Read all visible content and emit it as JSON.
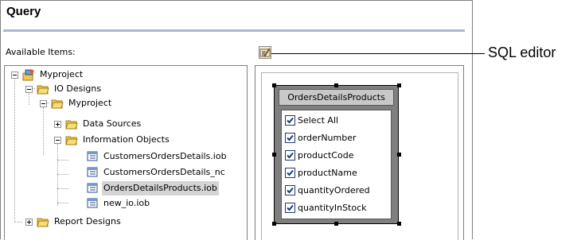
{
  "panel": {
    "title": "Query",
    "available_label": "Available Items:"
  },
  "toolbar": {
    "sql_editor_icon": "sql-editor-icon"
  },
  "callout": {
    "text": "SQL editor"
  },
  "tree": {
    "root": {
      "label": "Myproject",
      "icon": "project-icon"
    },
    "io_designs": {
      "label": "IO Designs",
      "icon": "folder-icon"
    },
    "myproject": {
      "label": "Myproject",
      "icon": "folder-icon"
    },
    "data_sources": {
      "label": "Data Sources",
      "icon": "folder-icon"
    },
    "information_objects": {
      "label": "Information Objects",
      "icon": "folder-icon"
    },
    "items": [
      {
        "label": "CustomersOrdersDetails.iob",
        "icon": "information-object-icon"
      },
      {
        "label": "CustomersOrdersDetails_nc",
        "icon": "information-object-icon"
      },
      {
        "label": "OrdersDetailsProducts.iob",
        "icon": "information-object-icon",
        "selected": true
      },
      {
        "label": "new_io.iob",
        "icon": "information-object-icon"
      }
    ],
    "report_designs": {
      "label": "Report Designs",
      "icon": "folder-icon"
    }
  },
  "table": {
    "title": "OrdersDetailsProducts",
    "fields": [
      {
        "label": "Select All",
        "checked": true
      },
      {
        "label": "orderNumber",
        "checked": true
      },
      {
        "label": "productCode",
        "checked": true
      },
      {
        "label": "productName",
        "checked": true
      },
      {
        "label": "quantityOrdered",
        "checked": true
      },
      {
        "label": "quantityInStock",
        "checked": true
      }
    ]
  },
  "colors": {
    "title_rule": "#a9b7d4",
    "selection": "#d4d4d4",
    "checkbox": "#1c3b6e",
    "folder": "#f2c94c"
  }
}
